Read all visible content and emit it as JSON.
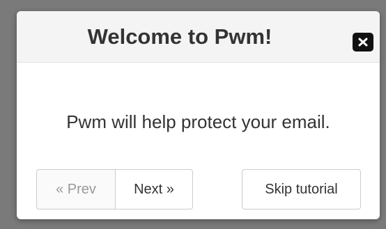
{
  "dialog": {
    "title": "Welcome to Pwm!",
    "message": "Pwm will help protect your email.",
    "close_icon": "close-icon"
  },
  "buttons": {
    "prev_label": "« Prev",
    "next_label": "Next »",
    "skip_label": "Skip tutorial"
  },
  "colors": {
    "backdrop": "#7a7a7a",
    "header_bg": "#f4f4f4",
    "text": "#333333",
    "disabled_text": "#999999",
    "close_bg": "#111111"
  }
}
